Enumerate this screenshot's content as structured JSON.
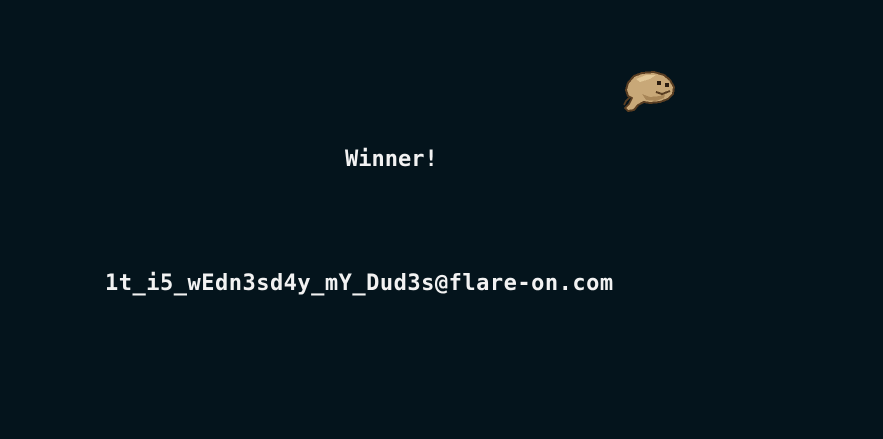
{
  "game": {
    "winner_text": "Winner!",
    "flag_email": "1t_i5_wEdn3sd4y_mY_Dud3s@flare-on.com",
    "sprite": "frog-icon",
    "colors": {
      "background": "#04141c",
      "text": "#f2f2f2",
      "frog_body": "#c8a878",
      "frog_outline": "#5a3e22"
    }
  }
}
